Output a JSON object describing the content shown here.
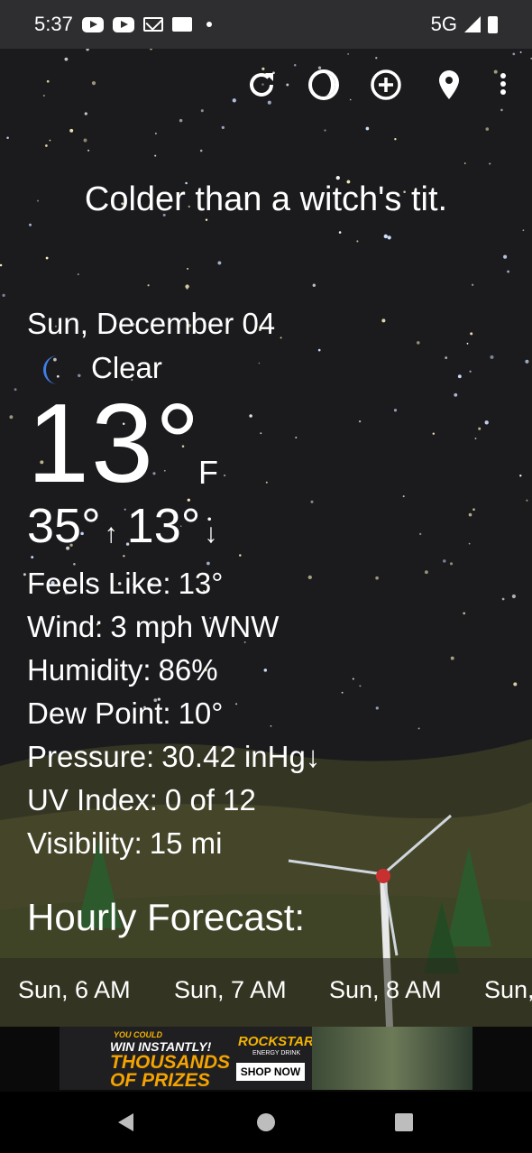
{
  "status_bar": {
    "time": "5:37",
    "icons": [
      "youtube-icon",
      "youtube-icon",
      "gmail-icon",
      "news-icon",
      "dot-icon"
    ],
    "network": "5G",
    "signal_icon": "signal-icon",
    "battery_icon": "battery-icon"
  },
  "toolbar": {
    "icons": [
      "refresh-icon",
      "theme-icon",
      "add-location-icon",
      "location-pin-icon",
      "more-vert-icon"
    ]
  },
  "tagline": "Colder than a witch's tit.",
  "current": {
    "date": "Sun, December 04",
    "condition_icon": "moon-icon",
    "condition": "Clear",
    "temperature": "13°",
    "unit": "F",
    "high": "35°",
    "high_arrow": "↑",
    "low": "13°",
    "low_arrow": "↓"
  },
  "details": [
    {
      "label": "Feels Like:",
      "value": "13°"
    },
    {
      "label": "Wind:",
      "value": "3 mph WNW"
    },
    {
      "label": "Humidity:",
      "value": "86%"
    },
    {
      "label": "Dew Point:",
      "value": "10°"
    },
    {
      "label": "Pressure:",
      "value": "30.42 inHg↓"
    },
    {
      "label": "UV Index:",
      "value": "0 of 12"
    },
    {
      "label": "Visibility:",
      "value": "15 mi"
    }
  ],
  "hourly": {
    "title": "Hourly Forecast:",
    "items": [
      {
        "label": "Sun, 6 AM"
      },
      {
        "label": "Sun, 7 AM"
      },
      {
        "label": "Sun, 8 AM"
      },
      {
        "label": "Sun,"
      }
    ]
  },
  "ad": {
    "line1": "YOU COULD",
    "line2": "WIN INSTANTLY!",
    "line3a": "THOUSANDS",
    "line3b": "OF PRIZES",
    "brand": "ROCKSTAR",
    "brand_sub": "ENERGY DRINK",
    "cta": "SHOP NOW"
  },
  "nav_bar": {
    "back_icon": "back-icon",
    "home_icon": "home-icon",
    "recents_icon": "recents-icon"
  },
  "colors": {
    "status_bar": "#2e2e30",
    "sky": "#1b1b1e",
    "moon_icon": "#3f7ee8",
    "ad_accent": "#f4a300"
  }
}
